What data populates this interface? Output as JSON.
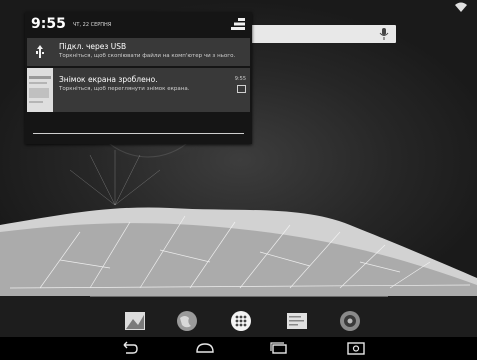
{
  "notification_shade": {
    "clock": "9:55",
    "date": "ЧТ, 22 СЕРПНЯ",
    "notifications": [
      {
        "title": "Підкл. через USB",
        "subtitle": "Торкніться, щоб скопіювати файли на комп'ютер чи з нього.",
        "icon": "usb-icon"
      },
      {
        "title": "Знімок екрана зроблено.",
        "subtitle": "Торкніться, щоб переглянути знімок екрана.",
        "time": "9:55",
        "icon": "screenshot-thumbnail"
      }
    ]
  },
  "icons": {
    "status": [
      "wifi-icon"
    ],
    "search": [
      "mic-icon"
    ],
    "dock": [
      "gallery-icon",
      "browser-icon",
      "all-apps-icon",
      "email-icon",
      "camera-icon"
    ],
    "nav": [
      "back-icon",
      "home-icon",
      "recents-icon",
      "screenshot-icon"
    ]
  },
  "colors": {
    "shade_background": "#151515",
    "notification_background": "#393939",
    "search_bar": "#e8e8e8"
  }
}
